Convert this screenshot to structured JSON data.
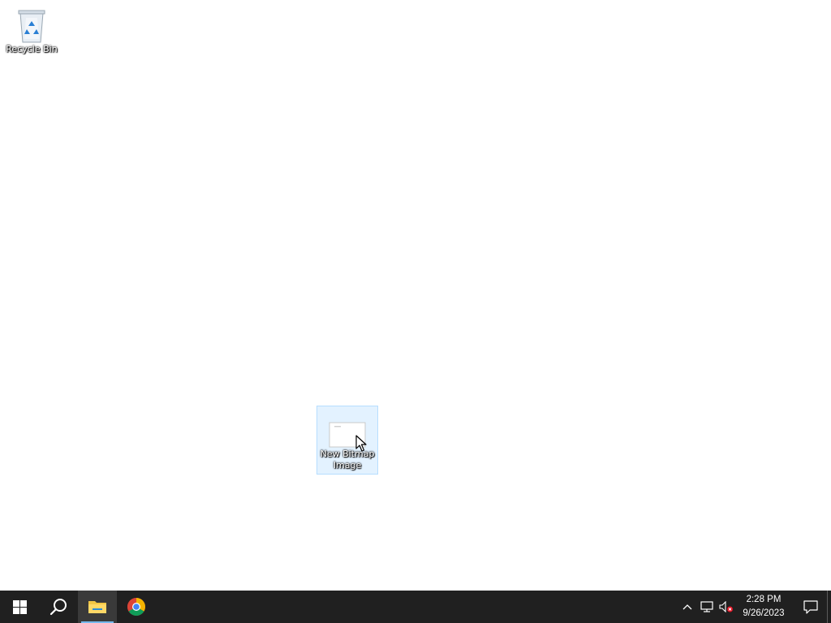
{
  "desktop": {
    "background_color": "#ffffff",
    "icons": [
      {
        "label": "Recycle Bin",
        "icon": "recycle-bin-icon"
      },
      {
        "label": "New Bitmap Image",
        "icon": "bitmap-file-icon",
        "selected": true
      }
    ],
    "overlay_text": {
      "content": "",
      "note": "Desktop text in the source image was an abusive slur and has been intentionally omitted."
    }
  },
  "taskbar": {
    "background_color": "#202020",
    "buttons": [
      {
        "name": "start",
        "icon": "windows-logo-icon",
        "active": false
      },
      {
        "name": "search",
        "icon": "search-icon",
        "active": false
      },
      {
        "name": "file-explorer",
        "icon": "folder-icon",
        "active": true
      },
      {
        "name": "chrome",
        "icon": "chrome-icon",
        "active": false
      }
    ],
    "tray": {
      "icons": [
        "chevron-up-icon",
        "network-icon",
        "volume-muted-icon"
      ],
      "clock": {
        "time": "2:28 PM",
        "date": "9/26/2023"
      },
      "action_center_icon": "notification-icon"
    }
  }
}
